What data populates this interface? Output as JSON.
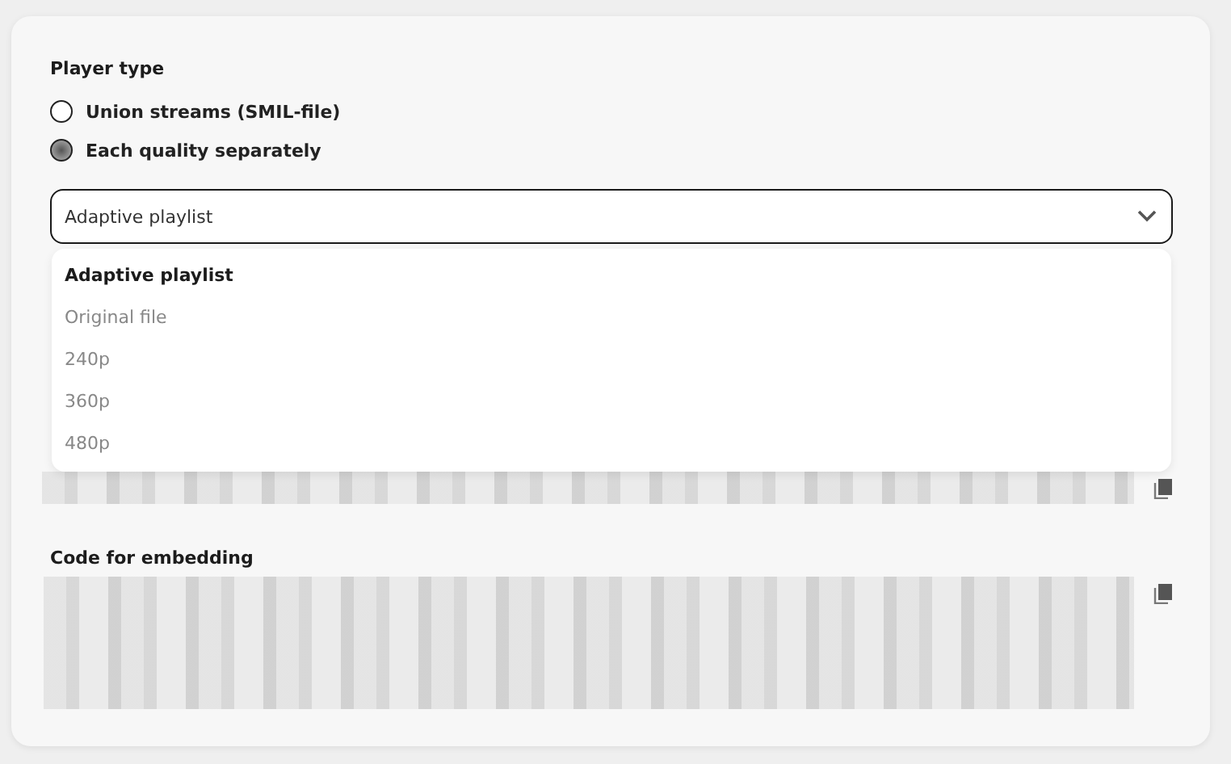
{
  "player_type": {
    "label": "Player type",
    "options": [
      {
        "label": "Union streams (SMIL-file)",
        "selected": false
      },
      {
        "label": "Each quality separately",
        "selected": true
      }
    ]
  },
  "select": {
    "value": "Adaptive playlist",
    "expanded": true,
    "options": [
      {
        "label": "Adaptive playlist",
        "selected": true
      },
      {
        "label": "Original file",
        "selected": false
      },
      {
        "label": "240p",
        "selected": false
      },
      {
        "label": "360p",
        "selected": false
      },
      {
        "label": "480p",
        "selected": false
      }
    ]
  },
  "embed": {
    "label": "Code for embedding"
  }
}
